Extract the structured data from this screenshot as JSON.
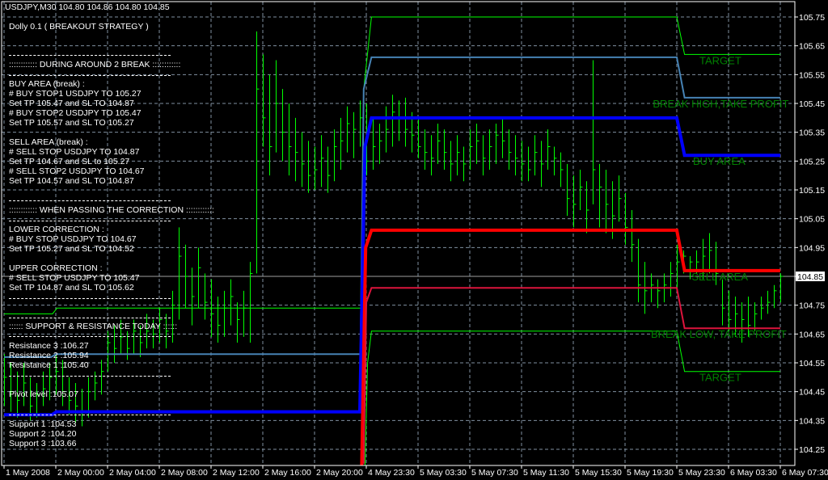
{
  "header": {
    "symbol_info": "USDJPY,M30  104.80 104.86 104.80 104.85"
  },
  "panel": {
    "title": "Dolly 0.1 ( BREAKOUT STRATEGY )",
    "during_header": ":::::::::::: DURING AROUND 2 BREAK ::::::::::::",
    "buy_area": [
      "BUY AREA (break) :",
      "# BUY STOP1  USDJPY TO 105.27",
      "Set TP 105.47 and SL TO 104.87",
      "# BUY STOP2  USDJPY TO 105.47",
      "Set TP 105.57 and SL TO 105.27"
    ],
    "sell_area": [
      "SELL AREA (break) :",
      "# SELL STOP  USDJPY TO 104.87",
      "Set TP 104.67 and SL to 105.27",
      "# SELL STOP2  USDJPY TO 104.67",
      "Set TP 104.57 and SL TO 104.87"
    ],
    "correction_header": ":::::::::::: WHEN PASSING THE CORRECTION ::::::::::::",
    "lower_correction": [
      "LOWER CORRECTION :",
      "# BUY STOP  USDJPY TO 104.67",
      "Set TP 105.27 and SL TO 104.52"
    ],
    "upper_correction": [
      "UPPER CORRECTION :",
      "# SELL STOP  USDJPY TO 105.47",
      "Set TP 104.87 and SL TO 105.62"
    ],
    "sr_header": ":::::: SUPPORT & RESISTANCE TODAY ::::::",
    "resistance": [
      "Resistance 3 :106.27",
      "Resistance 2 :105.94",
      "Resistance 1 :105.40"
    ],
    "pivot": "Pivot level :105.07",
    "support": [
      "Support 1 :104.53",
      "Support 2 :104.20",
      "Support 3 :103.66"
    ]
  },
  "colors": {
    "bg": "#000000",
    "bars": "#00ff00",
    "grid": "#8090a0",
    "label": "#008000",
    "axis": "#ffffff"
  },
  "chart_data": {
    "type": "ohlc",
    "symbol": "USDJPY",
    "timeframe": "M30",
    "current_price": 104.85,
    "ylim": [
      104.2,
      105.8
    ],
    "y_ticks": [
      105.75,
      105.65,
      105.55,
      105.45,
      105.35,
      105.25,
      105.15,
      105.05,
      104.95,
      104.85,
      104.75,
      104.65,
      104.55,
      104.45,
      104.35,
      104.25
    ],
    "y_tick_labels": [
      "105.75",
      "105.65",
      "105.55",
      "105.45",
      "105.35",
      "105.25",
      "105.15",
      "105.05",
      "104.95",
      "104.85",
      "104.75",
      "104.65",
      "104.55",
      "104.45",
      "104.35",
      "104.25"
    ],
    "current_price_label": "104.85",
    "x_labels": [
      "1 May 2008",
      "2 May 00:00",
      "2 May 04:00",
      "2 May 08:00",
      "2 May 12:00",
      "2 May 16:00",
      "2 May 20:00",
      "4 May 23:30",
      "5 May 03:30",
      "5 May 07:30",
      "5 May 11:30",
      "5 May 15:30",
      "5 May 19:30",
      "5 May 23:30",
      "6 May 03:30",
      "6 May 07:30"
    ],
    "x_label_every_bars": 8,
    "bars": [
      [
        104.58,
        104.4,
        104.5
      ],
      [
        104.55,
        104.38,
        104.45
      ],
      [
        104.52,
        104.36,
        104.42
      ],
      [
        104.55,
        104.4,
        104.48
      ],
      [
        104.5,
        104.35,
        104.4
      ],
      [
        104.48,
        104.36,
        104.44
      ],
      [
        104.52,
        104.4,
        104.46
      ],
      [
        104.55,
        104.42,
        104.5
      ],
      [
        104.58,
        104.44,
        104.52
      ],
      [
        104.56,
        104.4,
        104.45
      ],
      [
        104.5,
        104.37,
        104.42
      ],
      [
        104.48,
        104.34,
        104.4
      ],
      [
        104.46,
        104.33,
        104.38
      ],
      [
        104.5,
        104.36,
        104.45
      ],
      [
        104.52,
        104.42,
        104.48
      ],
      [
        104.56,
        104.44,
        104.52
      ],
      [
        104.66,
        104.52,
        104.62
      ],
      [
        104.68,
        104.55,
        104.6
      ],
      [
        104.7,
        104.58,
        104.64
      ],
      [
        104.66,
        104.56,
        104.6
      ],
      [
        104.7,
        104.58,
        104.66
      ],
      [
        104.68,
        104.57,
        104.62
      ],
      [
        104.72,
        104.6,
        104.66
      ],
      [
        104.7,
        104.6,
        104.65
      ],
      [
        104.74,
        104.62,
        104.7
      ],
      [
        104.72,
        104.6,
        104.66
      ],
      [
        104.8,
        104.62,
        104.75
      ],
      [
        105.02,
        104.7,
        104.92
      ],
      [
        104.96,
        104.74,
        104.85
      ],
      [
        104.88,
        104.68,
        104.78
      ],
      [
        104.95,
        104.74,
        104.88
      ],
      [
        104.86,
        104.7,
        104.76
      ],
      [
        104.84,
        104.64,
        104.72
      ],
      [
        104.78,
        104.62,
        104.68
      ],
      [
        104.8,
        104.64,
        104.74
      ],
      [
        104.84,
        104.68,
        104.78
      ],
      [
        104.76,
        104.62,
        104.7
      ],
      [
        104.8,
        104.64,
        104.74
      ],
      [
        104.9,
        104.62,
        104.86
      ],
      [
        105.7,
        104.86,
        105.5
      ],
      [
        105.62,
        105.3,
        105.4
      ],
      [
        105.55,
        105.2,
        105.3
      ],
      [
        105.6,
        105.28,
        105.45
      ],
      [
        105.5,
        105.25,
        105.35
      ],
      [
        105.45,
        105.2,
        105.3
      ],
      [
        105.4,
        105.18,
        105.28
      ],
      [
        105.35,
        105.16,
        105.24
      ],
      [
        105.32,
        105.14,
        105.2
      ],
      [
        105.3,
        105.15,
        105.22
      ],
      [
        105.34,
        105.16,
        105.26
      ],
      [
        105.3,
        105.14,
        105.2
      ],
      [
        105.36,
        105.18,
        105.3
      ],
      [
        105.4,
        105.22,
        105.32
      ],
      [
        105.44,
        105.28,
        105.38
      ],
      [
        105.42,
        105.26,
        105.36
      ],
      [
        105.46,
        105.3,
        105.4
      ],
      [
        105.45,
        105.2,
        105.25
      ],
      [
        105.4,
        105.22,
        105.3
      ],
      [
        105.38,
        105.24,
        105.32
      ],
      [
        105.44,
        105.28,
        105.36
      ],
      [
        105.48,
        105.3,
        105.42
      ],
      [
        105.46,
        105.32,
        105.4
      ],
      [
        105.47,
        105.3,
        105.36
      ],
      [
        105.42,
        105.28,
        105.34
      ],
      [
        105.4,
        105.26,
        105.3
      ],
      [
        105.36,
        105.22,
        105.28
      ],
      [
        105.34,
        105.2,
        105.26
      ],
      [
        105.38,
        105.24,
        105.32
      ],
      [
        105.36,
        105.22,
        105.28
      ],
      [
        105.32,
        105.18,
        105.24
      ],
      [
        105.34,
        105.2,
        105.28
      ],
      [
        105.3,
        105.18,
        105.24
      ],
      [
        105.36,
        105.22,
        105.3
      ],
      [
        105.38,
        105.24,
        105.32
      ],
      [
        105.34,
        105.2,
        105.26
      ],
      [
        105.36,
        105.22,
        105.3
      ],
      [
        105.38,
        105.24,
        105.34
      ],
      [
        105.4,
        105.26,
        105.32
      ],
      [
        105.36,
        105.22,
        105.28
      ],
      [
        105.34,
        105.2,
        105.26
      ],
      [
        105.32,
        105.18,
        105.24
      ],
      [
        105.3,
        105.18,
        105.22
      ],
      [
        105.34,
        105.2,
        105.28
      ],
      [
        105.32,
        105.16,
        105.24
      ],
      [
        105.36,
        105.22,
        105.3
      ],
      [
        105.3,
        105.2,
        105.26
      ],
      [
        105.28,
        105.16,
        105.22
      ],
      [
        105.24,
        105.06,
        105.12
      ],
      [
        105.2,
        105.02,
        105.1
      ],
      [
        105.22,
        105.08,
        105.16
      ],
      [
        105.18,
        105.0,
        105.08
      ],
      [
        105.6,
        105.1,
        105.22
      ],
      [
        105.24,
        105.02,
        105.16
      ],
      [
        105.22,
        105.0,
        105.1
      ],
      [
        105.18,
        104.98,
        105.06
      ],
      [
        105.2,
        105.04,
        105.12
      ],
      [
        105.14,
        104.96,
        105.02
      ],
      [
        105.08,
        104.9,
        104.96
      ],
      [
        104.98,
        104.76,
        104.82
      ],
      [
        104.9,
        104.72,
        104.8
      ],
      [
        104.86,
        104.76,
        104.82
      ],
      [
        104.84,
        104.74,
        104.8
      ],
      [
        104.86,
        104.76,
        104.82
      ],
      [
        104.9,
        104.78,
        104.86
      ],
      [
        104.96,
        104.8,
        104.9
      ],
      [
        104.94,
        104.86,
        104.92
      ],
      [
        104.92,
        104.84,
        104.9
      ],
      [
        104.94,
        104.86,
        104.9
      ],
      [
        104.98,
        104.84,
        104.92
      ],
      [
        105.0,
        104.86,
        104.94
      ],
      [
        104.97,
        104.82,
        104.86
      ],
      [
        104.84,
        104.68,
        104.74
      ],
      [
        104.8,
        104.66,
        104.7
      ],
      [
        104.78,
        104.64,
        104.72
      ],
      [
        104.76,
        104.62,
        104.7
      ],
      [
        104.78,
        104.64,
        104.68
      ],
      [
        104.76,
        104.66,
        104.72
      ],
      [
        104.78,
        104.7,
        104.74
      ],
      [
        104.8,
        104.72,
        104.76
      ],
      [
        104.82,
        104.74,
        104.8
      ],
      [
        104.86,
        104.76,
        104.85
      ]
    ],
    "lines": [
      {
        "name": "target-high",
        "color": "#00ff00",
        "width": 1,
        "points": [
          [
            0,
            104.72
          ],
          [
            7.5,
            104.72
          ],
          [
            8.2,
            104.74
          ],
          [
            55.2,
            104.74
          ],
          [
            55.6,
            105.5
          ],
          [
            56.8,
            105.75
          ],
          [
            104,
            105.75
          ],
          [
            105.2,
            105.62
          ],
          [
            120,
            105.62
          ]
        ]
      },
      {
        "name": "break-high-take-profit",
        "color": "#4682b4",
        "width": 2,
        "points": [
          [
            0,
            104.57
          ],
          [
            7.3,
            104.57
          ],
          [
            8,
            104.58
          ],
          [
            55.1,
            104.58
          ],
          [
            55.6,
            105.5
          ],
          [
            56.8,
            105.61
          ],
          [
            104,
            105.61
          ],
          [
            105.2,
            105.47
          ],
          [
            120,
            105.47
          ]
        ]
      },
      {
        "name": "buy-area",
        "color": "#0000ff",
        "width": 4,
        "points": [
          [
            0,
            104.37
          ],
          [
            7.4,
            104.37
          ],
          [
            8.1,
            104.38
          ],
          [
            55,
            104.38
          ],
          [
            55.8,
            105.3
          ],
          [
            56.8,
            105.4
          ],
          [
            104,
            105.4
          ],
          [
            105.2,
            105.27
          ],
          [
            120,
            105.27
          ]
        ]
      },
      {
        "name": "sell-area",
        "color": "#ff0000",
        "width": 4,
        "points": [
          [
            55.3,
            104.0
          ],
          [
            55.9,
            104.95
          ],
          [
            56.8,
            105.01
          ],
          [
            104,
            105.01
          ],
          [
            105.2,
            104.87
          ],
          [
            120,
            104.87
          ]
        ]
      },
      {
        "name": "break-low-take-profit",
        "color": "#dc143c",
        "width": 2,
        "points": [
          [
            55.6,
            104.2
          ],
          [
            56,
            104.76
          ],
          [
            56.8,
            104.81
          ],
          [
            104,
            104.81
          ],
          [
            105.2,
            104.67
          ],
          [
            120,
            104.67
          ]
        ]
      },
      {
        "name": "target-low",
        "color": "#00ff00",
        "width": 1,
        "points": [
          [
            55.8,
            104.0
          ],
          [
            56.2,
            104.55
          ],
          [
            56.8,
            104.66
          ],
          [
            104,
            104.66
          ],
          [
            105.2,
            104.52
          ],
          [
            120,
            104.52
          ]
        ]
      }
    ],
    "annotations": [
      {
        "text": "TARGET",
        "price": 105.62,
        "bar": 107.5
      },
      {
        "text": "BREAK HIGH,TAKE PROFIT",
        "price": 105.47,
        "bar": 100.3
      },
      {
        "text": "BUY AREA",
        "price": 105.27,
        "bar": 106.5
      },
      {
        "text": "SELL AREA",
        "price": 104.87,
        "bar": 106.3
      },
      {
        "text": "BREAK LOW, TAKE PROFIT",
        "price": 104.67,
        "bar": 100
      },
      {
        "text": "TARGET",
        "price": 104.52,
        "bar": 107.5
      }
    ]
  }
}
